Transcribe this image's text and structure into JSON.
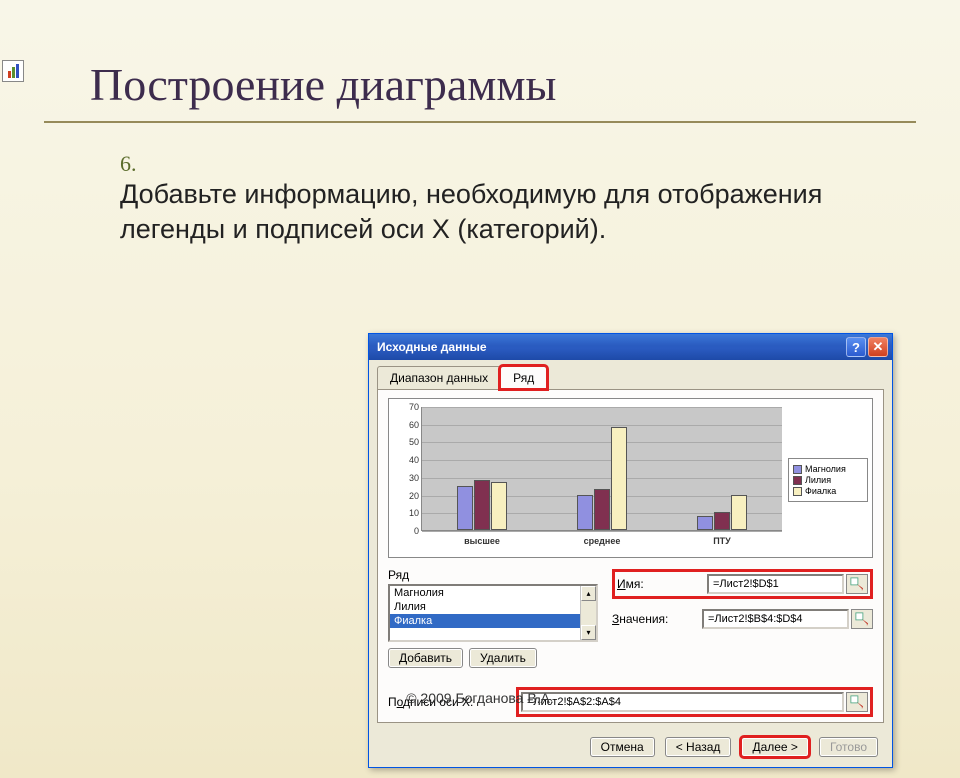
{
  "slide": {
    "title": "Построение диаграммы",
    "item_number": "6.",
    "item_text": "Добавьте информацию, необходимую для отображения легенды и подписей оси X (категорий)."
  },
  "dialog": {
    "title": "Исходные данные",
    "tabs": {
      "range": "Диапазон данных",
      "series": "Ряд"
    },
    "series_label": "Ряд",
    "series_items": [
      "Магнолия",
      "Лилия",
      "Фиалка"
    ],
    "selected_series": "Фиалка",
    "add_btn": "Добавить",
    "remove_btn": "Удалить",
    "name_label": "Имя:",
    "name_value": "=Лист2!$D$1",
    "values_label": "Значения:",
    "values_value": "=Лист2!$B$4:$D$4",
    "xlabels_label": "Подписи оси X:",
    "xlabels_value": "=Лист2!$A$2:$A$4",
    "buttons": {
      "cancel": "Отмена",
      "back": "< Назад",
      "next": "Далее >",
      "finish": "Готово"
    }
  },
  "chart_data": {
    "type": "bar",
    "categories": [
      "высшее",
      "среднее",
      "ПТУ"
    ],
    "series": [
      {
        "name": "Магнолия",
        "values": [
          25,
          20,
          8
        ]
      },
      {
        "name": "Лилия",
        "values": [
          28,
          23,
          10
        ]
      },
      {
        "name": "Фиалка",
        "values": [
          27,
          58,
          20
        ]
      }
    ],
    "ylim": [
      0,
      70
    ],
    "yticks": [
      0,
      10,
      20,
      30,
      40,
      50,
      60,
      70
    ],
    "legend_position": "right"
  },
  "footer": {
    "copyright": "© 2009 Богданова В.А."
  }
}
